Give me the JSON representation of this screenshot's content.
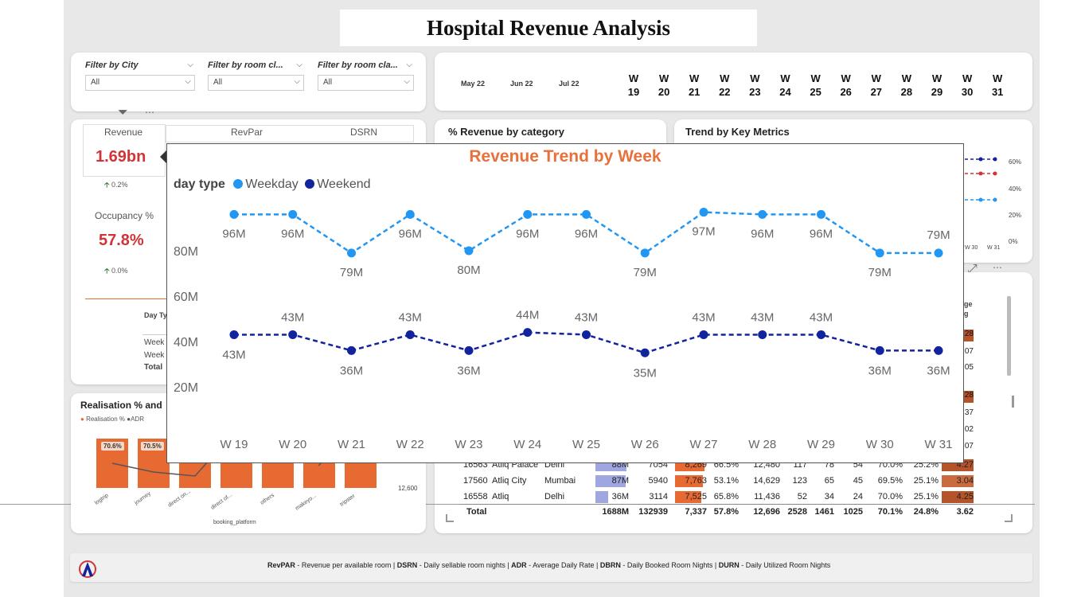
{
  "report_title": "Hospital Revenue Analysis",
  "filters": [
    {
      "label": "Filter by City",
      "value": "All"
    },
    {
      "label": "Filter by room cl...",
      "value": "All"
    },
    {
      "label": "Filter by room cla...",
      "value": "All"
    }
  ],
  "timeline": {
    "months": [
      "May 22",
      "Jun 22",
      "Jul 22"
    ],
    "weeks": [
      {
        "w": "W",
        "n": "19"
      },
      {
        "w": "W",
        "n": "20"
      },
      {
        "w": "W",
        "n": "21"
      },
      {
        "w": "W",
        "n": "22"
      },
      {
        "w": "W",
        "n": "23"
      },
      {
        "w": "W",
        "n": "24"
      },
      {
        "w": "W",
        "n": "25"
      },
      {
        "w": "W",
        "n": "26"
      },
      {
        "w": "W",
        "n": "27"
      },
      {
        "w": "W",
        "n": "28"
      },
      {
        "w": "W",
        "n": "29"
      },
      {
        "w": "W",
        "n": "30"
      },
      {
        "w": "W",
        "n": "31"
      }
    ]
  },
  "kpi": {
    "tabs": [
      "Revenue",
      "RevPar",
      "DSRN"
    ],
    "revenue_value": "1.69bn",
    "revenue_delta": "0.2%",
    "occupancy_label": "Occupancy %",
    "occupancy_value": "57.8%",
    "occupancy_delta": "0.0%",
    "day_type_label": "Day Ty",
    "day_rows": [
      "Week",
      "Week",
      "Total"
    ]
  },
  "category_card": {
    "title": "% Revenue by category"
  },
  "trend_card": {
    "title": "Trend by Key Metrics",
    "y_ticks": [
      "60%",
      "40%",
      "20%",
      "0%"
    ],
    "x_ticks": [
      "W 30",
      "W 31"
    ]
  },
  "realisation": {
    "title": "Realisation % and",
    "legend": [
      "Realisation %",
      "ADR"
    ],
    "bar_labels": [
      "70.6%",
      "70.5%"
    ],
    "platforms": [
      "logtrip",
      "journey",
      "direct on...",
      "direct of...",
      "others",
      "makeyo...",
      "tripster"
    ],
    "x_title": "booking_platform",
    "right_tick": "12,600"
  },
  "table": {
    "header_frag": "ge",
    "header_frag2": "g",
    "side_values": [
      "28",
      "07",
      "05",
      "28",
      "37",
      "02",
      "07"
    ],
    "rows": [
      {
        "id": "16563",
        "name": "Atliq Palace",
        "city": "Delhi",
        "rev": "88M",
        "c1": "7054",
        "adr": "8,269",
        "occ": "66.5%",
        "c2": "12,480",
        "c3": "117",
        "c4": "78",
        "c5": "54",
        "real": "70.0%",
        "pct": "25.2%",
        "rating": "4.27"
      },
      {
        "id": "17560",
        "name": "Atliq City",
        "city": "Mumbai",
        "rev": "87M",
        "c1": "5940",
        "adr": "7,763",
        "occ": "53.1%",
        "c2": "14,629",
        "c3": "123",
        "c4": "65",
        "c5": "45",
        "real": "69.5%",
        "pct": "25.1%",
        "rating": "3.04"
      },
      {
        "id": "16558",
        "name": "Atliq",
        "city": "Delhi",
        "rev": "36M",
        "c1": "3114",
        "adr": "7,525",
        "occ": "65.8%",
        "c2": "11,436",
        "c3": "52",
        "c4": "34",
        "c5": "24",
        "real": "70.0%",
        "pct": "25.1%",
        "rating": "4.25"
      }
    ],
    "total": {
      "label": "Total",
      "rev": "1688M",
      "c1": "132939",
      "adr": "7,337",
      "occ": "57.8%",
      "c2": "12,696",
      "c3": "2528",
      "c4": "1461",
      "c5": "1025",
      "real": "70.1%",
      "pct": "24.8%",
      "rating": "3.62"
    }
  },
  "footer": {
    "t1": "RevPAR",
    "d1": " - Revenue per available room | ",
    "t2": "DSRN",
    "d2": " - Daily sellable room nights | ",
    "t3": "ADR",
    "d3": " - Average Daily Rate | ",
    "t4": "DBRN",
    "d4": " - Daily Booked Room Nights | ",
    "t5": "DURN",
    "d5": " - Daily Utilized Room Nights"
  },
  "colors": {
    "weekday": "#2196f3",
    "weekend": "#12239e",
    "accent": "#e8703a",
    "kpi": "#d13438"
  },
  "chart_data": {
    "type": "line",
    "title": "Revenue Trend by Week",
    "legend_title": "day type",
    "categories": [
      "W 19",
      "W 20",
      "W 21",
      "W 22",
      "W 23",
      "W 24",
      "W 25",
      "W 26",
      "W 27",
      "W 28",
      "W 29",
      "W 30",
      "W 31"
    ],
    "series": [
      {
        "name": "Weekday",
        "values": [
          96,
          96,
          79,
          96,
          80,
          96,
          96,
          79,
          97,
          96,
          96,
          79,
          79
        ],
        "labels": [
          "96M",
          "96M",
          "79M",
          "96M",
          "80M",
          "96M",
          "96M",
          "79M",
          "97M",
          "96M",
          "96M",
          "79M",
          "79M"
        ]
      },
      {
        "name": "Weekend",
        "values": [
          43,
          43,
          36,
          43,
          36,
          44,
          43,
          35,
          43,
          43,
          43,
          36,
          36
        ],
        "labels": [
          "43M",
          "43M",
          "36M",
          "43M",
          "36M",
          "44M",
          "43M",
          "35M",
          "43M",
          "43M",
          "43M",
          "36M",
          "36M"
        ]
      }
    ],
    "y_ticks": [
      "80M",
      "60M",
      "40M",
      "20M"
    ],
    "ylim": [
      0,
      105
    ],
    "grid": false,
    "legend_position": "top-left"
  }
}
